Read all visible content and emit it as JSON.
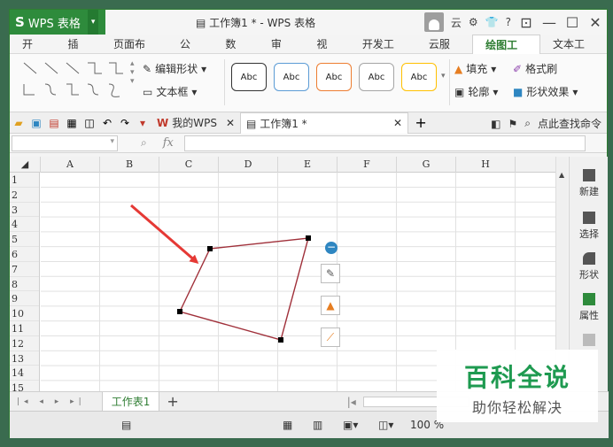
{
  "app": {
    "name": "WPS 表格",
    "window_title": "工作簿1 * - WPS 表格"
  },
  "titlebar": {
    "cloud": "云",
    "help": "?"
  },
  "tabs": [
    {
      "label": "开始"
    },
    {
      "label": "插入"
    },
    {
      "label": "页面布局"
    },
    {
      "label": "公式"
    },
    {
      "label": "数据"
    },
    {
      "label": "审阅"
    },
    {
      "label": "视图"
    },
    {
      "label": "开发工具"
    },
    {
      "label": "云服务"
    },
    {
      "label": "绘图工具",
      "active": true
    },
    {
      "label": "文本工具"
    }
  ],
  "ribbon": {
    "edit_shape": "编辑形状",
    "textbox": "文本框",
    "style_boxes": [
      {
        "label": "Abc",
        "color": "#333333"
      },
      {
        "label": "Abc",
        "color": "#5b9bd5"
      },
      {
        "label": "Abc",
        "color": "#ed7d31"
      },
      {
        "label": "Abc",
        "color": "#a5a5a5"
      },
      {
        "label": "Abc",
        "color": "#ffc000"
      }
    ],
    "fill": "填充",
    "format_painter": "格式刷",
    "outline": "轮廓",
    "shape_effects": "形状效果"
  },
  "quickbar": {
    "my_wps": "我的WPS",
    "doc_tab": "工作簿1 *",
    "search": "点此查找命令"
  },
  "formula": {
    "fx": "fx"
  },
  "grid": {
    "columns": [
      "A",
      "B",
      "C",
      "D",
      "E",
      "F",
      "G",
      "H"
    ],
    "rows": [
      "1",
      "2",
      "3",
      "4",
      "5",
      "6",
      "7",
      "8",
      "9",
      "10",
      "11",
      "12",
      "13",
      "14",
      "15"
    ]
  },
  "right_panel": {
    "items": [
      {
        "label": "新建"
      },
      {
        "label": "选择"
      },
      {
        "label": "形状"
      },
      {
        "label": "属性"
      }
    ]
  },
  "sheets": [
    {
      "label": "工作表1",
      "active": true
    }
  ],
  "statusbar": {
    "zoom": "100 %"
  },
  "watermark": {
    "line1": "百科全说",
    "line2": "助你轻松解决"
  },
  "colors": {
    "accent": "#2e7d32",
    "shape_outline": "#a0303a",
    "arrow": "#e53935"
  }
}
